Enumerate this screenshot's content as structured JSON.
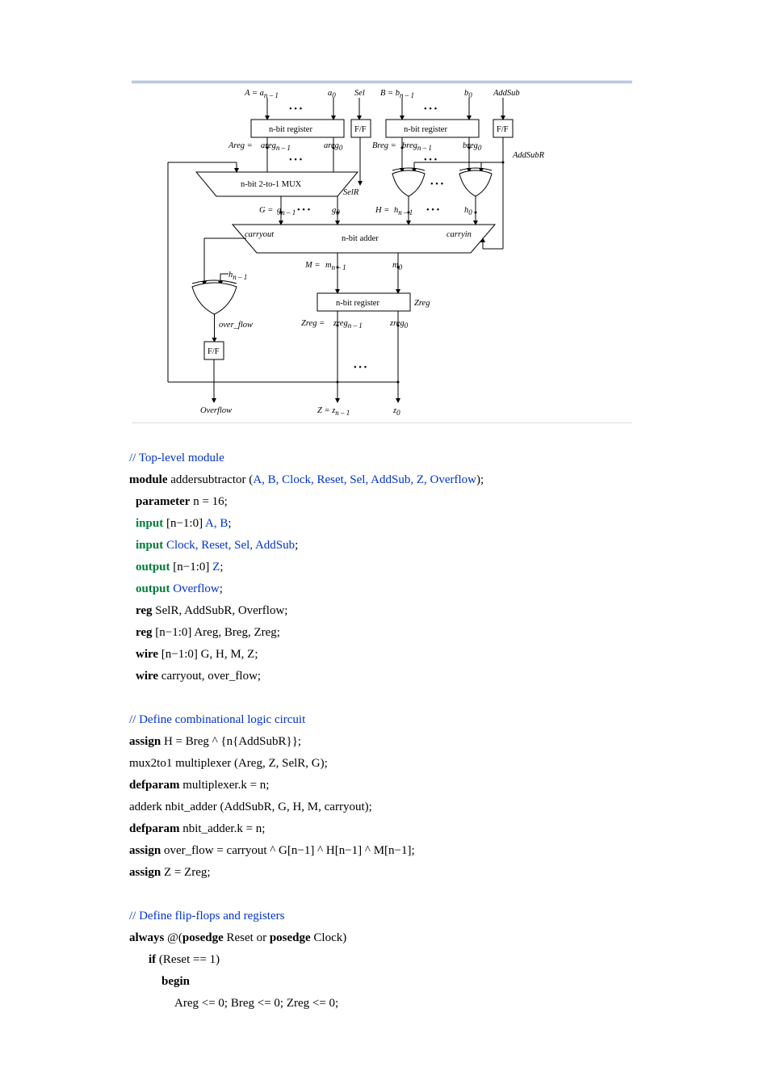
{
  "diagram": {
    "top_inputs": {
      "A": "A =",
      "a_msb": "a",
      "a_msb_sub": "n – 1",
      "a0": "a",
      "a0_sub": "0",
      "Sel": "Sel",
      "B": "B =",
      "b_msb": "b",
      "b_msb_sub": "n – 1",
      "b0": "b",
      "b0_sub": "0",
      "AddSub": "AddSub"
    },
    "dots": "•  •  •",
    "boxes": {
      "regA": "n-bit register",
      "ffSel": "F/F",
      "regB": "n-bit register",
      "ffAS": "F/F",
      "mux": "n-bit 2-to-1 MUX",
      "adder": "n-bit adder",
      "regZ": "n-bit register",
      "ffOv": "F/F"
    },
    "wires": {
      "Areg": "Areg =",
      "areg_msb": "areg",
      "areg_msb_sub": "n – 1",
      "areg0": "areg",
      "areg0_sub": "0",
      "Breg": "Breg =",
      "breg_msb": "breg",
      "breg_msb_sub": "n – 1",
      "breg0": "breg",
      "breg0_sub": "0",
      "AddSubR": "AddSubR",
      "SelR": "SelR",
      "G": "G =",
      "g_msb": "g",
      "g_msb_sub": "n – 1",
      "g0": "g",
      "g0_sub": "0",
      "H": "H =",
      "h_msb": "h",
      "h_msb_sub": "n – 1",
      "h0": "h",
      "h0_sub": "0",
      "carryout": "carryout",
      "carryin": "carryin",
      "M": "M =",
      "m_msb": "m",
      "m_msb_sub": "n – 1",
      "m0": "m",
      "m0_sub": "0",
      "hn1": "h",
      "hn1_sub": "n – 1",
      "over_flow": "over_flow",
      "Zreg": "Zreg",
      "Zreg2": "Zreg =",
      "zreg_msb": "zreg",
      "zreg_msb_sub": "n – 1",
      "zreg0": "zreg",
      "zreg0_sub": "0"
    },
    "outputs": {
      "Overflow": "Overflow",
      "Z": "Z =",
      "z_msb": "z",
      "z_msb_sub": "n – 1",
      "z0": "z",
      "z0_sub": "0"
    }
  },
  "code": {
    "c01": "// Top-level module",
    "c02a": "module",
    "c02b": " addersubtractor (",
    "c02c": "A, B, Clock, Reset, Sel, AddSub, Z, Overflow",
    "c02d": ");",
    "c03a": "parameter",
    "c03b": " n = 16;",
    "c04a": "input",
    "c04b": " [n−1:0] ",
    "c04c": "A, B",
    "c04d": ";",
    "c05a": "input",
    "c05b": " ",
    "c05c": "Clock, Reset, Sel, AddSub",
    "c05d": ";",
    "c06a": "output",
    "c06b": " [n−1:0] ",
    "c06c": "Z",
    "c06d": ";",
    "c07a": "output",
    "c07b": " ",
    "c07c": "Overflow",
    "c07d": ";",
    "c08a": "reg",
    "c08b": " SelR, AddSubR, Overflow;",
    "c09a": "reg",
    "c09b": " [n−1:0] Areg, Breg, Zreg;",
    "c10a": "wire",
    "c10b": " [n−1:0] G, H, M, Z;",
    "c11a": "wire",
    "c11b": " carryout, over_flow;",
    "c12": "// Define combinational logic circuit",
    "c13a": "assign",
    "c13b": " H = Breg ^ {n{AddSubR}};",
    "c14": "mux2to1 multiplexer (Areg, Z, SelR, G);",
    "c15a": "defparam",
    "c15b": " multiplexer.k = n;",
    "c16": "adderk nbit_adder (AddSubR, G, H, M, carryout);",
    "c17a": "defparam",
    "c17b": " nbit_adder.k = n;",
    "c18a": "assign",
    "c18b": " over_flow = carryout ^ G[n−1] ^ H[n−1] ^ M[n−1];",
    "c19a": "assign",
    "c19b": " Z = Zreg;",
    "c20": "// Define flip-flops and registers",
    "c21a": "always",
    "c21b": " @(",
    "c21c": "posedge",
    "c21d": " Reset or ",
    "c21e": "posedge",
    "c21f": " Clock)",
    "c22a": "if",
    "c22b": " (Reset == 1)",
    "c23": "begin",
    "c24": "Areg <= 0; Breg <= 0; Zreg <= 0;"
  }
}
